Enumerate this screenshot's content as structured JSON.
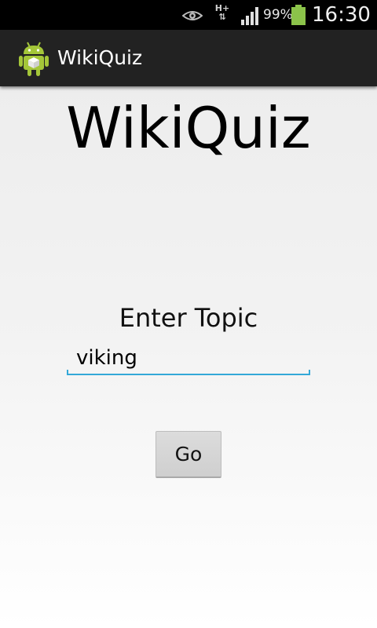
{
  "status_bar": {
    "battery_percent": "99%",
    "time": "16:30",
    "network_type": "H+",
    "icons": [
      "eye-icon",
      "data-hplus-icon",
      "signal-icon",
      "battery-icon"
    ],
    "battery_color": "#8bc34a"
  },
  "action_bar": {
    "title": "WikiQuiz",
    "icon": "android-app-icon"
  },
  "main": {
    "heading": "WikiQuiz",
    "topic_label": "Enter Topic",
    "topic_input_value": "viking",
    "go_button_label": "Go"
  },
  "colors": {
    "accent": "#33a8d8",
    "action_bar_bg": "#222222",
    "status_bar_bg": "#000000"
  }
}
